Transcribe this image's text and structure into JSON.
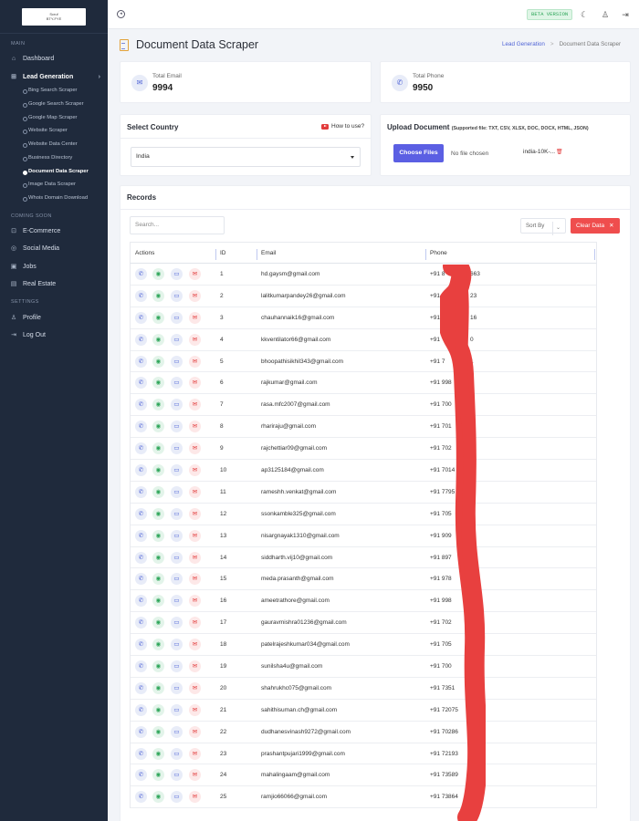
{
  "sidebar": {
    "logo_line1": "Scruf",
    "logo_line2": "BTY-FYE",
    "section_main": "MAIN",
    "section_coming": "COMING SOON",
    "section_settings": "SETTINGS",
    "dashboard": "Dashboard",
    "lead_generation": "Lead Generation",
    "sub_items": [
      "Bing Search Scraper",
      "Google Search Scraper",
      "Google Map Scraper",
      "Website Scraper",
      "Website Data Center",
      "Business Directory",
      "Document Data Scraper",
      "Image Data Scraper",
      "Whois Domain Download"
    ],
    "ecommerce": "E-Commerce",
    "social_media": "Social Media",
    "jobs": "Jobs",
    "real_estate": "Real Estate",
    "profile": "Profile",
    "logout": "Log Out"
  },
  "topbar": {
    "beta": "BETA VERSION"
  },
  "page": {
    "title": "Document Data Scraper",
    "breadcrumb_link": "Lead Generation",
    "breadcrumb_sep": ">",
    "breadcrumb_current": "Document Data Scraper"
  },
  "stats": {
    "email_label": "Total Email",
    "email_value": "9994",
    "phone_label": "Total Phone",
    "phone_value": "9950"
  },
  "country": {
    "title": "Select Country",
    "how_to": "How to use?",
    "selected": "India"
  },
  "upload": {
    "title": "Upload Document",
    "supported": "(Supported file: TXT, CSV, XLSX, DOC, DOCX, HTML, JSON)",
    "choose": "Choose Files",
    "no_file": "No file chosen",
    "file_name": "india-10K-..."
  },
  "records": {
    "title": "Records",
    "search_placeholder": "Search...",
    "sort_by": "Sort By",
    "clear": "Clear Data",
    "headers": {
      "actions": "Actions",
      "id": "ID",
      "email": "Email",
      "phone": "Phone"
    },
    "rows": [
      {
        "id": "1",
        "email": "hd.gaysm@gmail.com",
        "phone": "+91 8",
        "tail": "663"
      },
      {
        "id": "2",
        "email": "lalitkumarpandey26@gmail.com",
        "phone": "+91 7",
        "tail": "23"
      },
      {
        "id": "3",
        "email": "chauhannaik16@gmail.com",
        "phone": "+91",
        "tail": "16"
      },
      {
        "id": "4",
        "email": "kkventilator66@gmail.com",
        "phone": "+91",
        "tail": "0"
      },
      {
        "id": "5",
        "email": "bhoopathisikhil343@gmail.com",
        "phone": "+91 7",
        "tail": "1"
      },
      {
        "id": "6",
        "email": "rajkumar@gmail.com",
        "phone": "+91 998",
        "tail": ""
      },
      {
        "id": "7",
        "email": "rasa.mfc2007@gmail.com",
        "phone": "+91 700",
        "tail": ""
      },
      {
        "id": "8",
        "email": "rhariraju@gmail.com",
        "phone": "+91 701",
        "tail": ""
      },
      {
        "id": "9",
        "email": "rajchettiar09@gmail.com",
        "phone": "+91 702",
        "tail": ""
      },
      {
        "id": "10",
        "email": "ap3125184@gmail.com",
        "phone": "+91 7014",
        "tail": ""
      },
      {
        "id": "11",
        "email": "rameshh.venkat@gmail.com",
        "phone": "+91 7795",
        "tail": ""
      },
      {
        "id": "12",
        "email": "ssonkamble325@gmail.com",
        "phone": "+91 705",
        "tail": ""
      },
      {
        "id": "13",
        "email": "nisargnayak1310@gmail.com",
        "phone": "+91 909",
        "tail": ""
      },
      {
        "id": "14",
        "email": "siddharth.vij10@gmail.com",
        "phone": "+91 897",
        "tail": ""
      },
      {
        "id": "15",
        "email": "meda.prasanth@gmail.com",
        "phone": "+91 978",
        "tail": ""
      },
      {
        "id": "16",
        "email": "ameetrathore@gmail.com",
        "phone": "+91 998",
        "tail": ""
      },
      {
        "id": "17",
        "email": "gauravmishra01236@gmail.com",
        "phone": "+91 702",
        "tail": ""
      },
      {
        "id": "18",
        "email": "patelrajeshkumar034@gmail.com",
        "phone": "+91 705",
        "tail": ""
      },
      {
        "id": "19",
        "email": "sunilsha4u@gmail.com",
        "phone": "+91 700",
        "tail": ""
      },
      {
        "id": "20",
        "email": "shahrukhc075@gmail.com",
        "phone": "+91 7351",
        "tail": ""
      },
      {
        "id": "21",
        "email": "sahithisuman.ch@gmail.com",
        "phone": "+91 72075",
        "tail": ""
      },
      {
        "id": "22",
        "email": "dudhanesvinash9272@gmail.com",
        "phone": "+91 70286",
        "tail": ""
      },
      {
        "id": "23",
        "email": "prashantpujari1999@gmail.com",
        "phone": "+91 72193",
        "tail": ""
      },
      {
        "id": "24",
        "email": "mahalingaam@gmail.com",
        "phone": "+91 73589",
        "tail": ""
      },
      {
        "id": "25",
        "email": "ramjio66066@gmail.com",
        "phone": "+91 73864",
        "tail": ""
      }
    ]
  },
  "colors": {
    "sidebar": "#1f2a3c",
    "accent": "#5b5fe3",
    "danger": "#ef4d4d",
    "redaction": "#e8403f"
  },
  "icons": {
    "call": "phone-icon",
    "whatsapp": "whatsapp-icon",
    "sms": "message-icon",
    "mail": "mail-icon"
  }
}
